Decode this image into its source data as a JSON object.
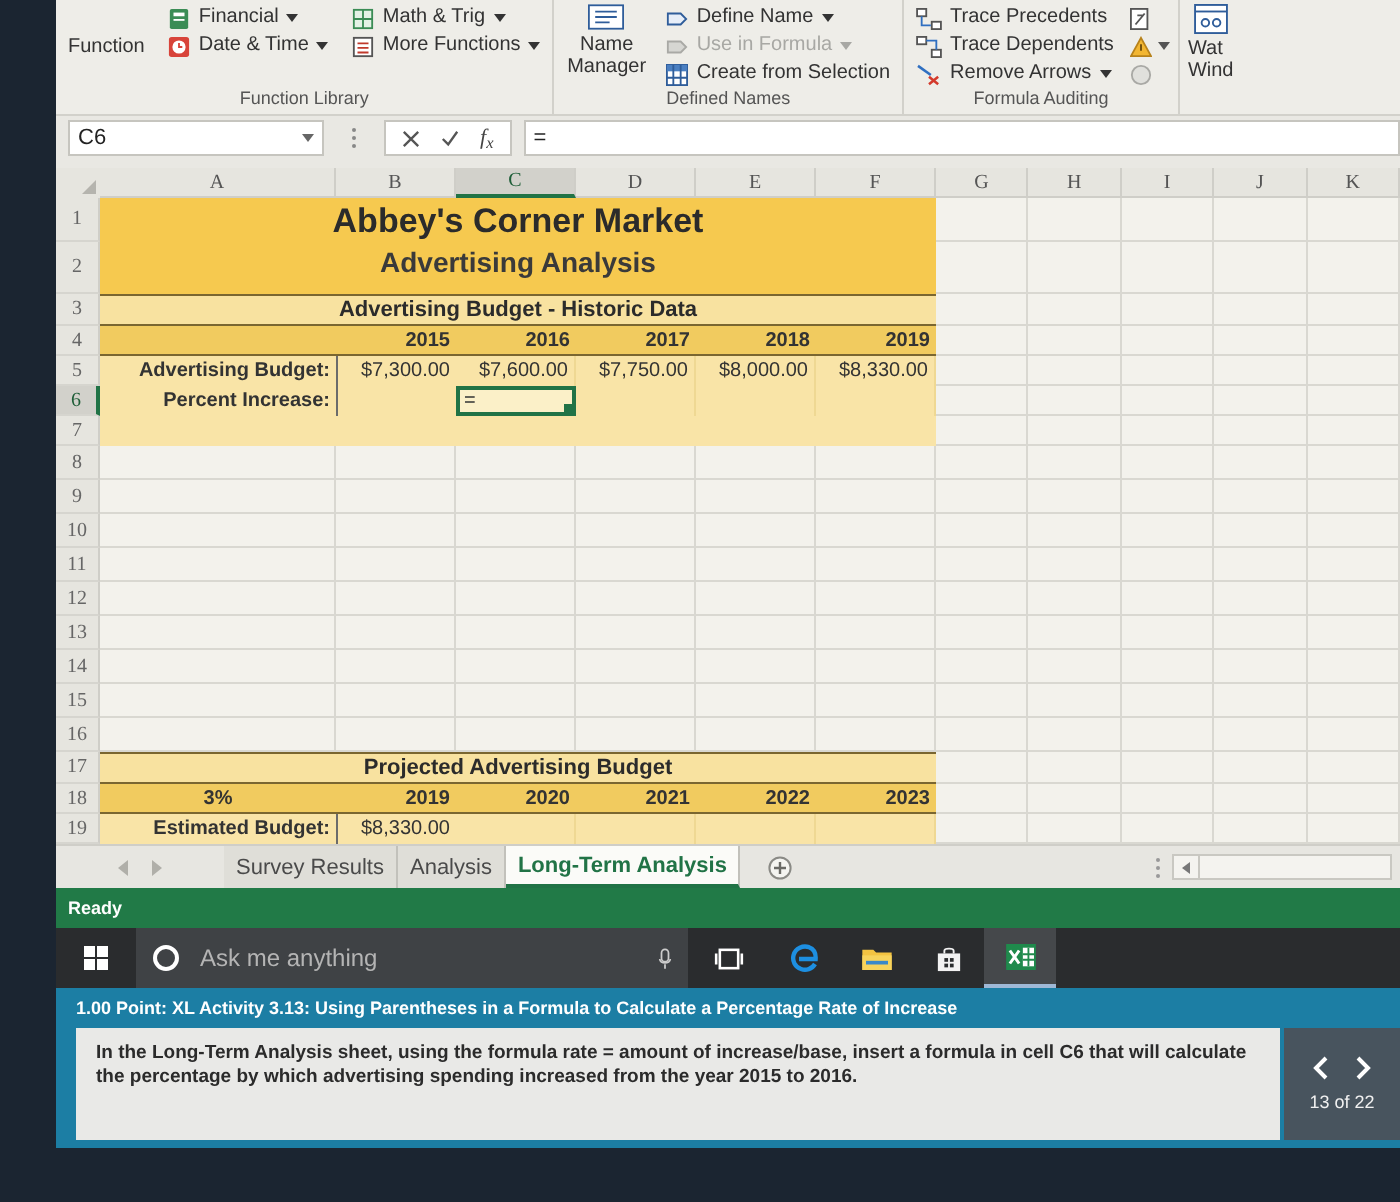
{
  "ribbon": {
    "function_library": {
      "label": "Function Library",
      "insert_function": "Function",
      "buttons": [
        {
          "label": "Financial",
          "dropdown": true
        },
        {
          "label": "Date & Time",
          "dropdown": true
        },
        {
          "label": "Math & Trig",
          "dropdown": true
        },
        {
          "label": "More Functions",
          "dropdown": true
        }
      ]
    },
    "defined_names": {
      "label": "Defined Names",
      "name_manager": "Name Manager",
      "buttons": [
        {
          "label": "Define Name",
          "dropdown": true,
          "disabled": false
        },
        {
          "label": "Use in Formula",
          "dropdown": true,
          "disabled": true
        },
        {
          "label": "Create from Selection",
          "dropdown": false,
          "disabled": false
        }
      ]
    },
    "formula_auditing": {
      "label": "Formula Auditing",
      "buttons": [
        {
          "label": "Trace Precedents",
          "dropdown": false
        },
        {
          "label": "Trace Dependents",
          "dropdown": false
        },
        {
          "label": "Remove Arrows",
          "dropdown": true
        }
      ]
    },
    "watch_window": {
      "line_1": "Wat",
      "line_2": "Wind"
    }
  },
  "formula_bar": {
    "name_box": "C6",
    "function_symbol": "f$_{x}$",
    "formula": "="
  },
  "sheet": {
    "columns": [
      {
        "label": "A",
        "selected": false
      },
      {
        "label": "B",
        "selected": false
      },
      {
        "label": "C",
        "selected": true
      },
      {
        "label": "D",
        "selected": false
      },
      {
        "label": "E",
        "selected": false
      },
      {
        "label": "F",
        "selected": false
      },
      {
        "label": "G",
        "selected": false
      },
      {
        "label": "H",
        "selected": false
      },
      {
        "label": "I",
        "selected": false
      },
      {
        "label": "J",
        "selected": false
      },
      {
        "label": "K",
        "selected": false
      }
    ],
    "rows": [
      {
        "number": "1",
        "selected": false,
        "kind": "title",
        "text": "Abbey's Corner Market"
      },
      {
        "number": "2",
        "selected": false,
        "kind": "subtitle",
        "text": "Advertising Analysis"
      },
      {
        "number": "3",
        "selected": false,
        "kind": "heading",
        "text": "Advertising Budget - Historic Data"
      },
      {
        "number": "4",
        "selected": false,
        "kind": "years",
        "values": [
          "2015",
          "2016",
          "2017",
          "2018",
          "2019"
        ]
      },
      {
        "number": "5",
        "selected": false,
        "kind": "values",
        "label": "Advertising Budget:",
        "cells": [
          {
            "text": "$7,300.00",
            "selected": false
          },
          {
            "text": "$7,600.00",
            "selected": false
          },
          {
            "text": "$7,750.00",
            "selected": false
          },
          {
            "text": "$8,000.00",
            "selected": false
          },
          {
            "text": "$8,330.00",
            "selected": false
          }
        ]
      },
      {
        "number": "6",
        "selected": true,
        "kind": "values",
        "label": "Percent Increase:",
        "cells": [
          {
            "selected": false
          },
          {
            "text": "=",
            "selected": true
          },
          {
            "selected": false
          },
          {
            "selected": false
          },
          {
            "selected": false
          }
        ]
      },
      {
        "number": "7",
        "selected": false,
        "kind": "band"
      },
      {
        "number": "8",
        "selected": false,
        "kind": "empty"
      },
      {
        "number": "9",
        "selected": false,
        "kind": "empty"
      },
      {
        "number": "10",
        "selected": false,
        "kind": "empty"
      },
      {
        "number": "11",
        "selected": false,
        "kind": "empty"
      },
      {
        "number": "12",
        "selected": false,
        "kind": "empty"
      },
      {
        "number": "13",
        "selected": false,
        "kind": "empty"
      },
      {
        "number": "14",
        "selected": false,
        "kind": "empty"
      },
      {
        "number": "15",
        "selected": false,
        "kind": "empty"
      },
      {
        "number": "16",
        "selected": false,
        "kind": "empty"
      },
      {
        "number": "17",
        "selected": false,
        "kind": "heading",
        "text": "Projected Advertising Budget"
      },
      {
        "number": "18",
        "selected": false,
        "kind": "years",
        "label": "3%",
        "values": [
          "2019",
          "2020",
          "2021",
          "2022",
          "2023"
        ]
      },
      {
        "number": "19",
        "selected": false,
        "kind": "values",
        "label": "Estimated Budget:",
        "cells": [
          {
            "text": "$8,330.00",
            "selected": false
          },
          {
            "selected": false
          },
          {
            "selected": false
          },
          {
            "selected": false
          },
          {
            "selected": false
          }
        ]
      }
    ]
  },
  "sheet_tabs": [
    {
      "label": "Survey Results",
      "selected": false
    },
    {
      "label": "Analysis",
      "selected": false
    },
    {
      "label": "Long-Term Analysis",
      "selected": true
    }
  ],
  "status_bar": {
    "text": "Ready"
  },
  "taskbar": {
    "search": {
      "placeholder": "Ask me anything"
    }
  },
  "question": {
    "title": "1.00 Point: XL Activity 3.13: Using Parentheses in a Formula to Calculate a Percentage Rate of Increase",
    "body": "In the Long-Term Analysis sheet, using the formula rate = amount of increase/base, insert a formula in cell C6 that will calculate the percentage by which advertising spending increased from the year 2015 to 2016.",
    "progress": "13 of 22"
  }
}
